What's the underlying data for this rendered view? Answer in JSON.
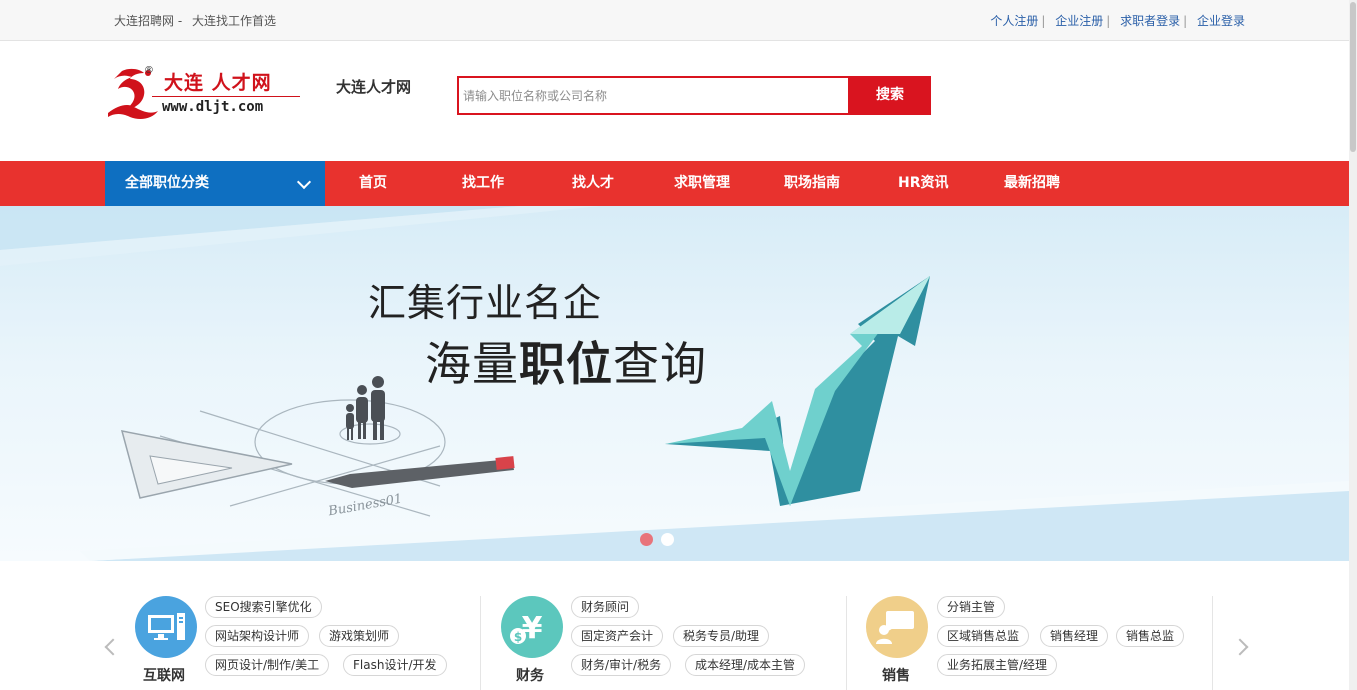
{
  "topbar": {
    "site_links": [
      "大连招聘网 -",
      "大连找工作首选"
    ],
    "links": [
      "个人注册",
      "企业注册",
      "求职者登录",
      "企业登录"
    ]
  },
  "header": {
    "logo_cn": "大连 人才网",
    "logo_url": "www.dljt.com",
    "site_name": "大连人才网",
    "search_placeholder": "请输入职位名称或公司名称",
    "search_button": "搜索"
  },
  "nav": {
    "category_label": "全部职位分类",
    "items": [
      "首页",
      "找工作",
      "找人才",
      "求职管理",
      "职场指南",
      "HR资讯",
      "最新招聘"
    ]
  },
  "banner": {
    "line1": "汇集行业名企",
    "line2_a": "海量",
    "line2_b": "职位",
    "line2_c": "查询",
    "board_text": "Business01",
    "active_slide": 1,
    "slide_count": 2
  },
  "categories": [
    {
      "name": "互联网",
      "icon": "monitor-icon",
      "color": "#4aa3df",
      "tags": [
        "SEO搜索引擎优化",
        "网站架构设计师",
        "游戏策划师",
        "网页设计/制作/美工",
        "Flash设计/开发"
      ]
    },
    {
      "name": "财务",
      "icon": "currency-icon",
      "color": "#5cc7bd",
      "tags": [
        "财务顾问",
        "固定资产会计",
        "税务专员/助理",
        "财务/审计/税务",
        "成本经理/成本主管"
      ]
    },
    {
      "name": "销售",
      "icon": "presenter-icon",
      "color": "#f0cf8a",
      "tags": [
        "分销主管",
        "区域销售总监",
        "销售经理",
        "销售总监",
        "业务拓展主管/经理"
      ]
    }
  ],
  "colors": {
    "accent_red": "#e8322e",
    "nav_blue": "#0e6fc1",
    "link_blue": "#2a5fa8"
  }
}
